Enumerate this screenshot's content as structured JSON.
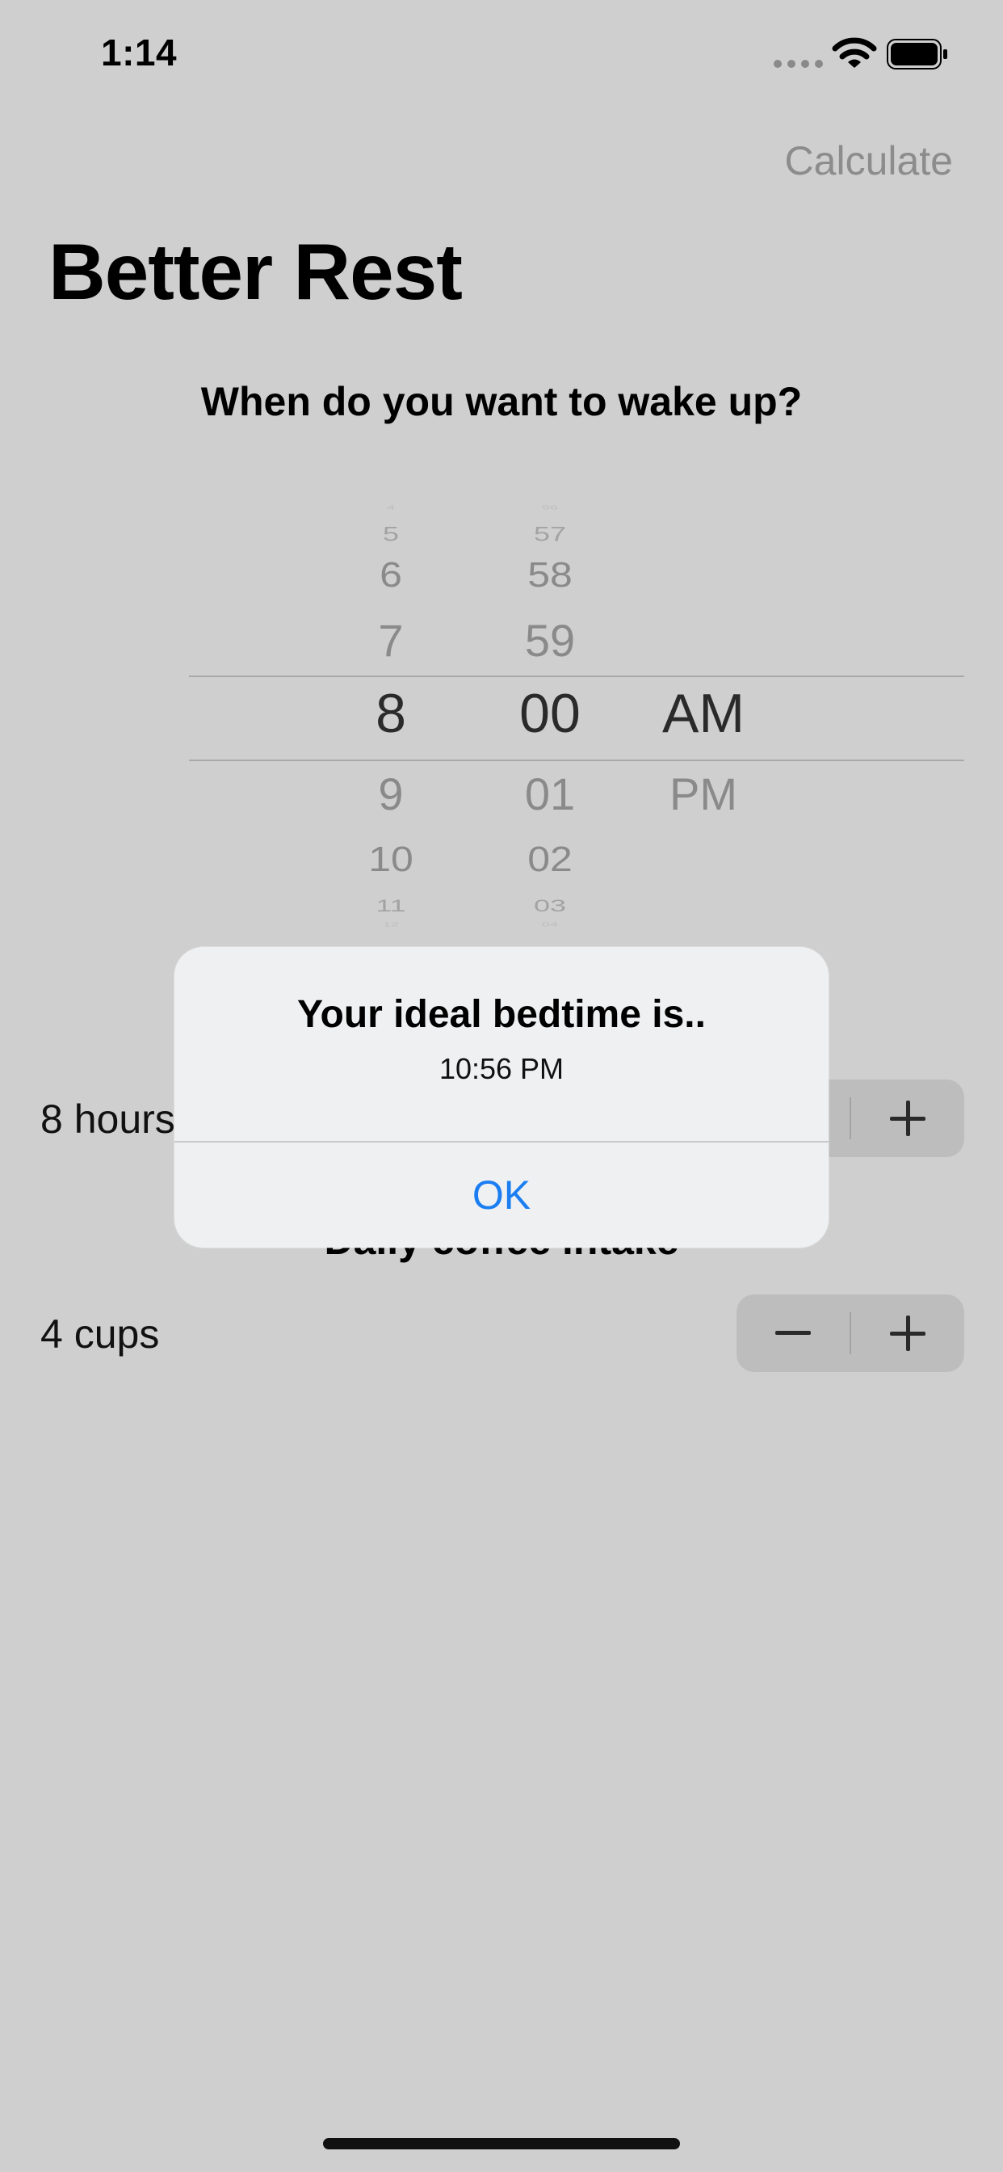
{
  "status_bar": {
    "time": "1:14"
  },
  "nav": {
    "action_label": "Calculate"
  },
  "page": {
    "title": "Better Rest"
  },
  "wake": {
    "question": "When do you want to wake up?",
    "picker": {
      "hours": [
        "4",
        "5",
        "6",
        "7",
        "8",
        "9",
        "10",
        "11",
        "12"
      ],
      "minutes": [
        "56",
        "57",
        "58",
        "59",
        "00",
        "01",
        "02",
        "03",
        "04"
      ],
      "periods": [
        "AM",
        "PM"
      ],
      "selected": {
        "hour": "8",
        "minute": "00",
        "period": "AM"
      }
    }
  },
  "sleep": {
    "value_label": "8 hours"
  },
  "coffee": {
    "section_title": "Daily coffee intake",
    "value_label": "4 cups"
  },
  "stepper": {
    "minus": "−",
    "plus": "+"
  },
  "alert": {
    "title": "Your ideal bedtime is..",
    "message": "10:56 PM",
    "button": "OK"
  },
  "colors": {
    "accent": "#1a7ef2",
    "background": "#cfcfcf"
  }
}
